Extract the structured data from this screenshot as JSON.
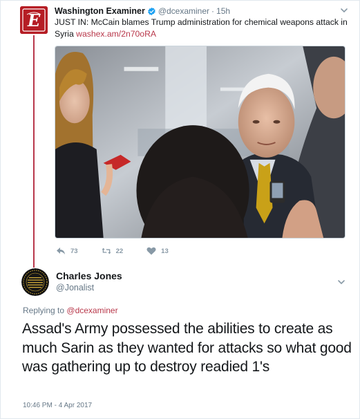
{
  "parent_tweet": {
    "author_name": "Washington Examiner",
    "handle": "@dcexaminer",
    "separator": "·",
    "time": "15h",
    "text": "JUST IN: McCain blames Trump administration for chemical weapons attack in Syria",
    "link": "washex.am/2n70oRA",
    "actions": {
      "reply_count": "73",
      "retweet_count": "22",
      "like_count": "13"
    }
  },
  "reply_tweet": {
    "author_name": "Charles Jones",
    "handle": "@Jonalist",
    "replying_prefix": "Replying to",
    "replying_to": "@dcexaminer",
    "text": "Assad's Army possessed the abilities to create as much Sarin as they wanted for attacks so what good was gathering up to destroy readied 1's",
    "timestamp": "10:46 PM - 4 Apr 2017"
  },
  "colors": {
    "accent": "#b8374a",
    "verified": "#1da1f2",
    "muted": "#657786",
    "action_gray": "#8899a6"
  },
  "icons": {
    "reply": "reply-icon",
    "retweet": "retweet-icon",
    "like": "heart-icon",
    "verified": "verified-badge-icon",
    "more": "chevron-down-icon"
  }
}
